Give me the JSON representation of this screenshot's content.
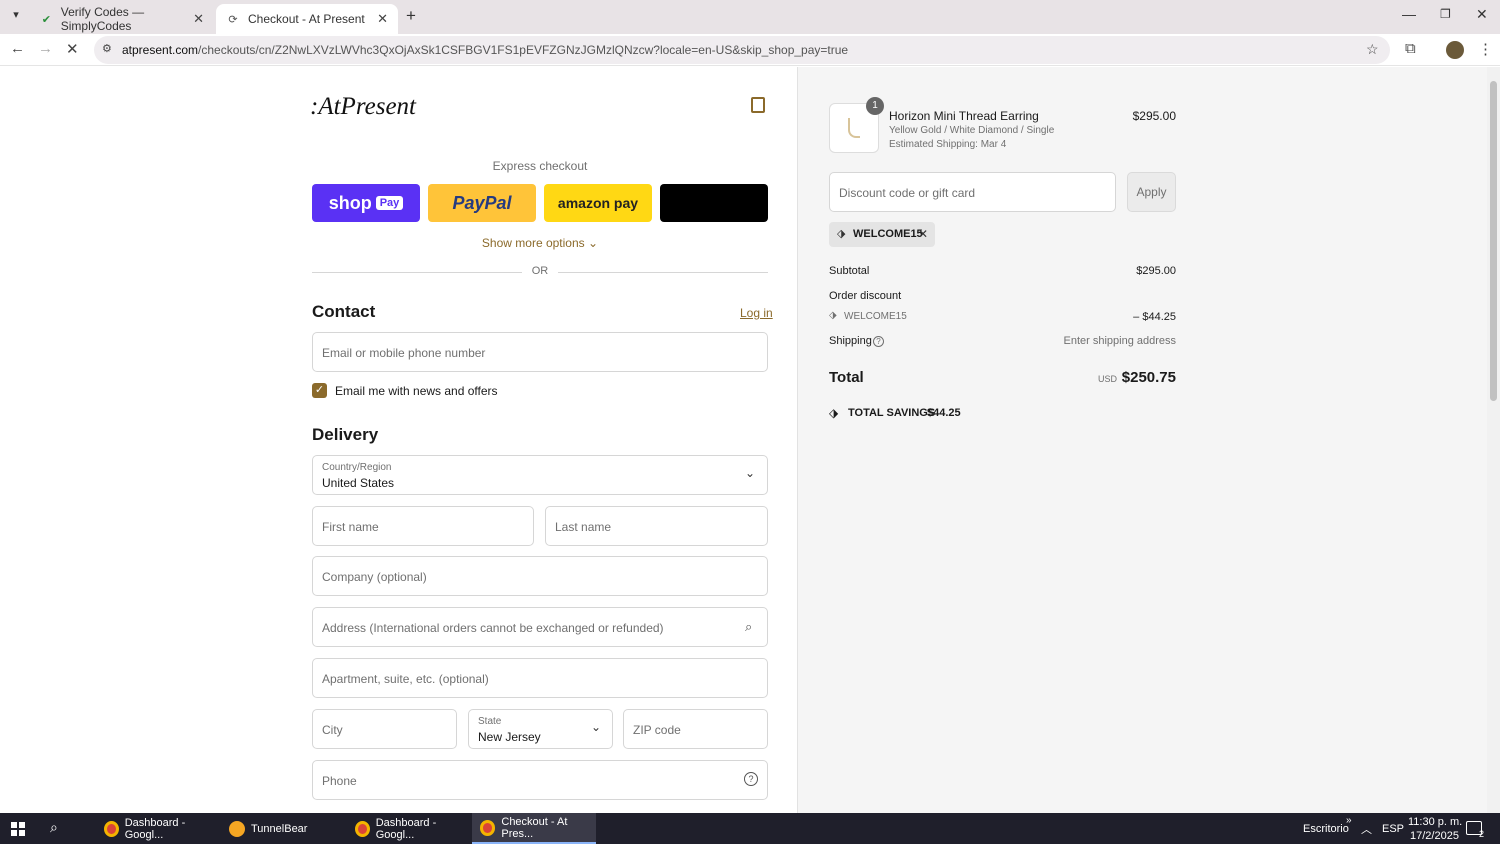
{
  "browser": {
    "tabs": [
      {
        "title": "Verify Codes — SimplyCodes",
        "active": false
      },
      {
        "title": "Checkout - At Present",
        "active": true
      }
    ],
    "new_tab": "+",
    "url": "atpresent.com/checkouts/cn/Z2NwLXVzLWVhc3QxOjAxSk1CSFBGV1FS1pEVFZGNzJGMzlQNzcw?locale=en-US&skip_shop_pay=true",
    "url_host": "atpresent.com",
    "url_path": "/checkouts/cn/Z2NwLXVzLWVhc3QxOjAxSk1CSFBGV1FS1pEVFZGNzJGMzlQNzcw?locale=en-US&skip_shop_pay=true"
  },
  "checkout": {
    "logo": ":AtPresent",
    "express_label": "Express checkout",
    "shop_pay": "shop",
    "shop_pay_badge": "Pay",
    "paypal": "PayPal",
    "amazon_pay": "amazon pay",
    "show_more": "Show more options",
    "or": "OR",
    "contact_heading": "Contact",
    "login": "Log in",
    "email_placeholder": "Email or mobile phone number",
    "newsletter": "Email me with news and offers",
    "delivery_heading": "Delivery",
    "country_label": "Country/Region",
    "country_value": "United States",
    "first_name": "First name",
    "last_name": "Last name",
    "company": "Company (optional)",
    "address": "Address (International orders cannot be exchanged or refunded)",
    "apartment": "Apartment, suite, etc. (optional)",
    "city": "City",
    "state_label": "State",
    "state_value": "New Jersey",
    "zip": "ZIP code",
    "phone": "Phone"
  },
  "summary": {
    "item": {
      "qty": "1",
      "name": "Horizon Mini Thread Earring",
      "variant": "Yellow Gold / White Diamond / Single",
      "shipping": "Estimated Shipping: Mar 4",
      "price": "$295.00"
    },
    "discount_placeholder": "Discount code or gift card",
    "apply": "Apply",
    "code": "WELCOME15",
    "subtotal_label": "Subtotal",
    "subtotal": "$295.00",
    "order_discount_label": "Order discount",
    "discount_code": "WELCOME15",
    "discount_value": "– $44.25",
    "shipping_label": "Shipping",
    "shipping_value": "Enter shipping address",
    "total_label": "Total",
    "currency": "USD",
    "total": "$250.75",
    "savings_label": "TOTAL SAVINGS",
    "savings": "$44.25"
  },
  "taskbar": {
    "items": [
      "Dashboard - Googl...",
      "TunnelBear",
      "Dashboard - Googl...",
      "Checkout - At Pres..."
    ],
    "desktop": "Escritorio",
    "lang": "ESP",
    "time": "11:30 p. m.",
    "date": "17/2/2025",
    "notif_count": "2"
  },
  "colors": {
    "shop_pay": "#5a31f4",
    "paypal": "#ffc439",
    "checkbox": "#8b6a2b",
    "link": "#8b6a2b"
  }
}
